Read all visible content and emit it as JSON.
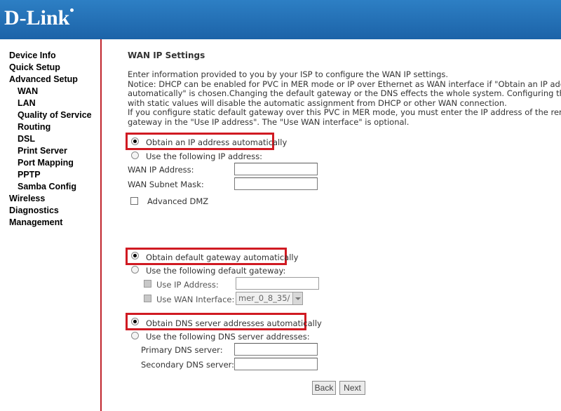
{
  "brand": {
    "logo_text": "D-Link"
  },
  "sidebar": {
    "items": [
      {
        "label": "Device Info"
      },
      {
        "label": "Quick Setup"
      },
      {
        "label": "Advanced Setup"
      },
      {
        "label": "WAN"
      },
      {
        "label": "LAN"
      },
      {
        "label": "Quality of Service"
      },
      {
        "label": "Routing"
      },
      {
        "label": "DSL"
      },
      {
        "label": "Print Server"
      },
      {
        "label": "Port Mapping"
      },
      {
        "label": "PPTP"
      },
      {
        "label": "Samba Config"
      },
      {
        "label": "Wireless"
      },
      {
        "label": "Diagnostics"
      },
      {
        "label": "Management"
      }
    ]
  },
  "main": {
    "title": "WAN IP Settings",
    "description": [
      "Enter information provided to you by your ISP to configure the WAN IP settings.",
      "Notice: DHCP can be enabled for PVC in MER mode or IP over Ethernet as WAN interface if \"Obtain an IP address",
      "automatically\" is chosen.Changing the default gateway or the DNS effects the whole system. Configuring them",
      "with static values will disable the automatic assignment from DHCP or other WAN connection.",
      "If you configure static default gateway over this PVC in MER mode, you must enter the IP address of the remote",
      "gateway in the \"Use IP address\". The \"Use WAN interface\" is optional."
    ],
    "ip": {
      "auto_label": "Obtain an IP address automatically",
      "static_label": "Use the following IP address:",
      "wan_ip_label": "WAN IP Address:",
      "wan_ip_value": "",
      "subnet_label": "WAN Subnet Mask:",
      "subnet_value": "",
      "dmz_label": "Advanced DMZ"
    },
    "gateway": {
      "auto_label": "Obtain default gateway automatically",
      "static_label": "Use the following default gateway:",
      "use_ip_label": "Use IP Address:",
      "use_ip_value": "",
      "use_wan_label": "Use WAN Interface:",
      "use_wan_selected": "mer_0_8_35/"
    },
    "dns": {
      "auto_label": "Obtain DNS server addresses automatically",
      "static_label": "Use the following DNS server addresses:",
      "primary_label": "Primary DNS server:",
      "primary_value": "",
      "secondary_label": "Secondary DNS server:",
      "secondary_value": ""
    },
    "buttons": {
      "back": "Back",
      "next": "Next"
    }
  },
  "colors": {
    "header": "#1c63a8",
    "accent_red": "#d01a22",
    "sidebar_rule": "#c0242c"
  }
}
